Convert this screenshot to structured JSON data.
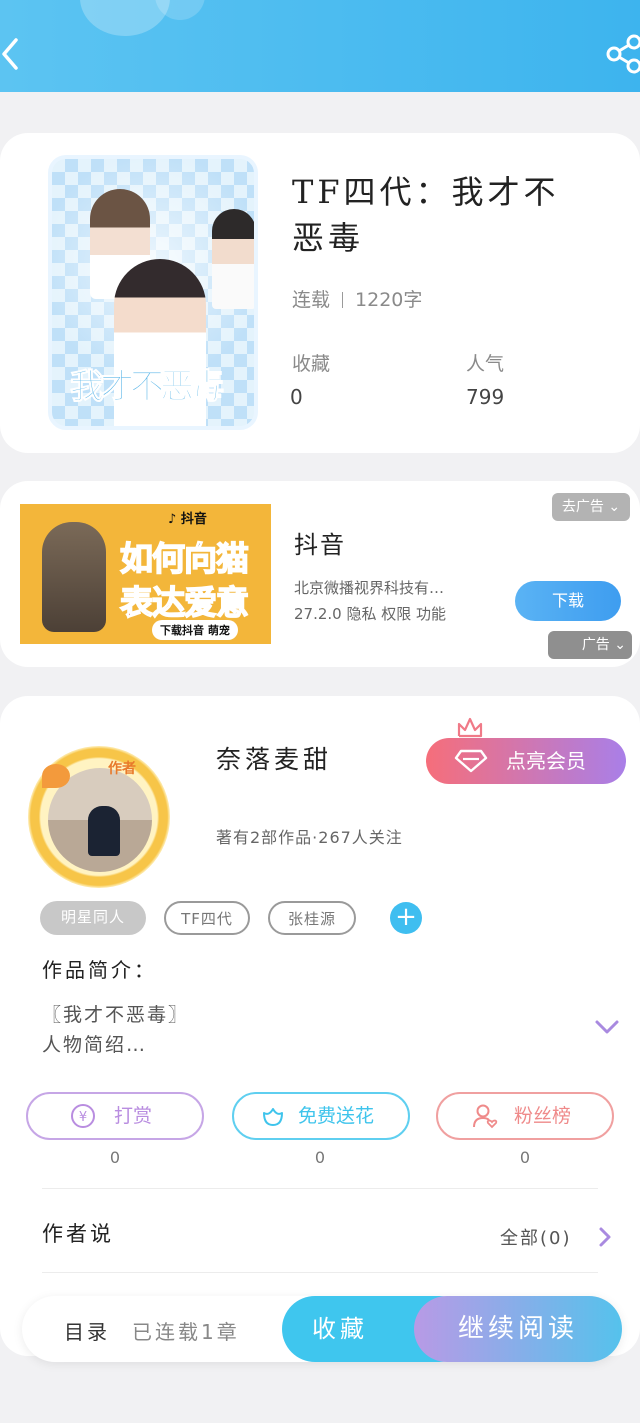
{
  "book": {
    "title": "TF四代：我才不恶毒",
    "status": "连载",
    "word_count": "1220字",
    "favorites_label": "收藏",
    "favorites_value": "0",
    "popularity_label": "人气",
    "popularity_value": "799",
    "cover_text": "我才不恶毒"
  },
  "ad": {
    "image_logo": "♪ 抖音",
    "image_headline_1": "如何向猫",
    "image_headline_2": "表达爱意",
    "image_pill": "下载抖音 萌宠",
    "remove_label": "去广告 ⌄",
    "app_name": "抖音",
    "company": "北京微播视界科技有…",
    "version_line": "27.2.0  隐私  权限  功能",
    "download_label": "下载",
    "ad_badge": "广告 ⌄"
  },
  "author": {
    "avatar_tag": "作者",
    "name": "奈落麦甜",
    "stats": "著有2部作品·267人关注",
    "vip_label": "点亮会员",
    "tags": [
      "明星同人",
      "TF四代",
      "张桂源"
    ],
    "add_tag": "+",
    "intro_title": "作品简介：",
    "intro_line1": "〖我才不恶毒〗",
    "intro_line2": "人物简绍…"
  },
  "actions": [
    {
      "label": "打赏",
      "count": "0",
      "color": "#b98de0"
    },
    {
      "label": "免费送花",
      "count": "0",
      "color": "#3fc4ec"
    },
    {
      "label": "粉丝榜",
      "count": "0",
      "color": "#ef8a8a"
    }
  ],
  "author_says": {
    "label": "作者说",
    "all_label": "全部(0)"
  },
  "bottom_bar": {
    "toc_label": "目录",
    "toc_status": "已连载1章",
    "collect_label": "收藏",
    "read_label": "继续阅读"
  }
}
